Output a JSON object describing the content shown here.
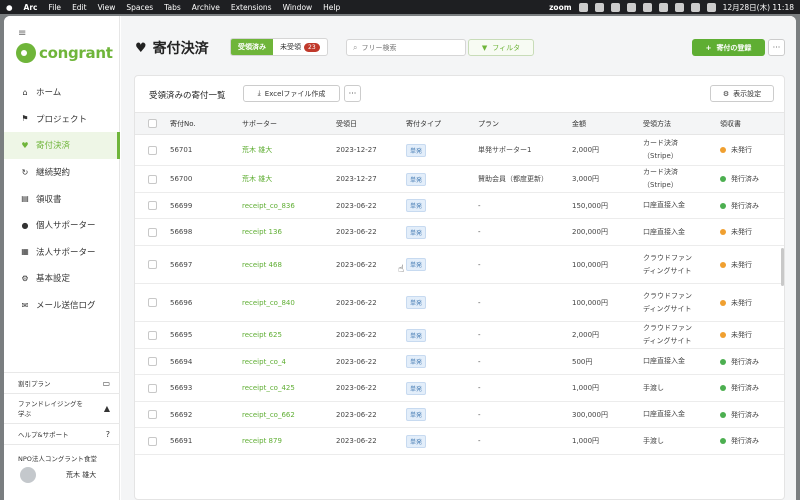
{
  "menubar": {
    "items": [
      "Arc",
      "File",
      "Edit",
      "View",
      "Spaces",
      "Tabs",
      "Archive",
      "Extensions",
      "Window",
      "Help"
    ],
    "zoom_label": "zoom",
    "datetime": "12月28日(木) 11:18"
  },
  "sidebar": {
    "logo": "congrant",
    "items": [
      {
        "label": "ホーム",
        "icon": "home-icon",
        "glyph": "⌂"
      },
      {
        "label": "プロジェクト",
        "icon": "flag-icon",
        "glyph": "⚑"
      },
      {
        "label": "寄付決済",
        "icon": "heart-icon",
        "glyph": "♥"
      },
      {
        "label": "継続契約",
        "icon": "refresh-icon",
        "glyph": "↻"
      },
      {
        "label": "領収書",
        "icon": "receipt-icon",
        "glyph": "▤"
      },
      {
        "label": "個人サポーター",
        "icon": "person-icon",
        "glyph": "●"
      },
      {
        "label": "法人サポーター",
        "icon": "building-icon",
        "glyph": "▦"
      },
      {
        "label": "基本設定",
        "icon": "gear-icon",
        "glyph": "⚙"
      },
      {
        "label": "メール送信ログ",
        "icon": "mail-icon",
        "glyph": "✉"
      }
    ],
    "bottom": {
      "plan": "割引プラン",
      "fundraising_l1": "ファンドレイジングを",
      "fundraising_l2": "学ぶ",
      "help": "ヘルプ&サポート",
      "org": "NPO法人コングラント食堂",
      "user": "荒木 雄大"
    }
  },
  "header": {
    "title": "寄付決済",
    "tab_received": "受領済み",
    "tab_unreceived": "未受領",
    "unreceived_count": "23",
    "search_placeholder": "フリー検索",
    "filter_label": "フィルタ",
    "register_label": "寄付の登録",
    "more_label": "···"
  },
  "card": {
    "title": "受領済みの寄付一覧",
    "excel_label": "Excelファイル作成",
    "more_label": "···",
    "display_settings": "表示設定"
  },
  "table": {
    "columns": [
      "寄付No.",
      "サポーター",
      "受領日",
      "寄付タイプ",
      "プラン",
      "金額",
      "受領方法",
      "領収書"
    ],
    "rows": [
      {
        "no": "56701",
        "supporter": "荒木 雄大",
        "date": "2023-12-27",
        "type": "単発",
        "plan": "単発サポーター1",
        "amount": "2,000円",
        "method_l1": "カード決済",
        "method_l2": "（Stripe）",
        "receipt": "未発行",
        "status": "unissued"
      },
      {
        "no": "56700",
        "supporter": "荒木 雄大",
        "date": "2023-12-27",
        "type": "単発",
        "plan": "賛助会員（都度更新）",
        "amount": "3,000円",
        "method_l1": "カード決済",
        "method_l2": "（Stripe）",
        "receipt": "発行済み",
        "status": "issued"
      },
      {
        "no": "56699",
        "supporter": "receipt_co_836",
        "date": "2023-06-22",
        "type": "単発",
        "plan": "-",
        "amount": "150,000円",
        "method_l1": "口座直接入金",
        "method_l2": "",
        "receipt": "発行済み",
        "status": "issued"
      },
      {
        "no": "56698",
        "supporter": "receipt 136",
        "date": "2023-06-22",
        "type": "単発",
        "plan": "-",
        "amount": "200,000円",
        "method_l1": "口座直接入金",
        "method_l2": "",
        "receipt": "未発行",
        "status": "unissued"
      },
      {
        "no": "56697",
        "supporter": "receipt 468",
        "date": "2023-06-22",
        "type": "単発",
        "plan": "-",
        "amount": "100,000円",
        "method_l1": "クラウドファン",
        "method_l2": "ディングサイト",
        "receipt": "未発行",
        "status": "unissued"
      },
      {
        "no": "56696",
        "supporter": "receipt_co_840",
        "date": "2023-06-22",
        "type": "単発",
        "plan": "-",
        "amount": "100,000円",
        "method_l1": "クラウドファン",
        "method_l2": "ディングサイト",
        "receipt": "未発行",
        "status": "unissued"
      },
      {
        "no": "56695",
        "supporter": "receipt 625",
        "date": "2023-06-22",
        "type": "単発",
        "plan": "-",
        "amount": "2,000円",
        "method_l1": "クラウドファン",
        "method_l2": "ディングサイト",
        "receipt": "未発行",
        "status": "unissued"
      },
      {
        "no": "56694",
        "supporter": "receipt_co_4",
        "date": "2023-06-22",
        "type": "単発",
        "plan": "-",
        "amount": "500円",
        "method_l1": "口座直接入金",
        "method_l2": "",
        "receipt": "発行済み",
        "status": "issued"
      },
      {
        "no": "56693",
        "supporter": "receipt_co_425",
        "date": "2023-06-22",
        "type": "単発",
        "plan": "-",
        "amount": "1,000円",
        "method_l1": "手渡し",
        "method_l2": "",
        "receipt": "発行済み",
        "status": "issued"
      },
      {
        "no": "56692",
        "supporter": "receipt_co_662",
        "date": "2023-06-22",
        "type": "単発",
        "plan": "-",
        "amount": "300,000円",
        "method_l1": "口座直接入金",
        "method_l2": "",
        "receipt": "発行済み",
        "status": "issued"
      },
      {
        "no": "56691",
        "supporter": "receipt 879",
        "date": "2023-06-22",
        "type": "単発",
        "plan": "-",
        "amount": "1,000円",
        "method_l1": "手渡し",
        "method_l2": "",
        "receipt": "発行済み",
        "status": "issued"
      }
    ]
  },
  "colors": {
    "accent": "#6fb53a",
    "issued": "#4caf50",
    "unissued": "#f0a030"
  }
}
